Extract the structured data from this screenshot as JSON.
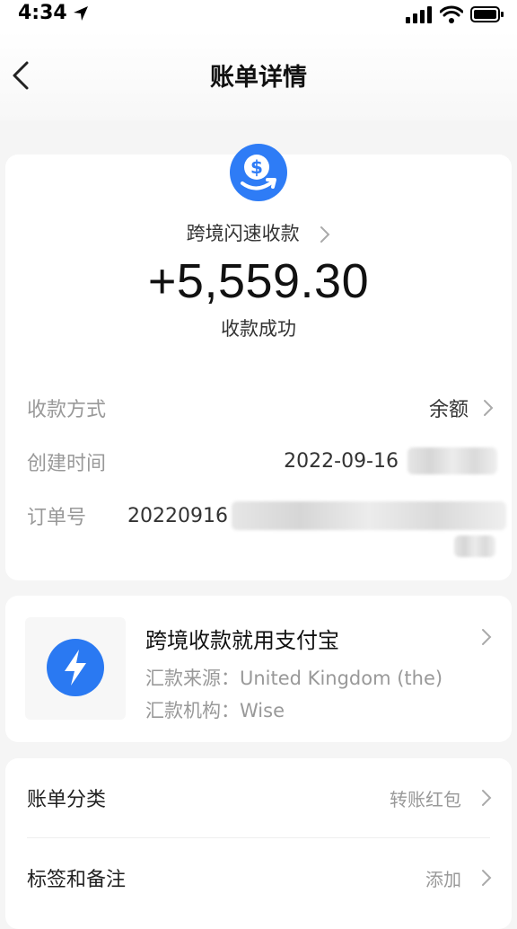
{
  "status_bar": {
    "time": "4:34"
  },
  "nav": {
    "title": "账单详情"
  },
  "summary": {
    "business_name": "跨境闪速收款",
    "amount": "+5,559.30",
    "status": "收款成功"
  },
  "details": {
    "payment_method_label": "收款方式",
    "payment_method_value": "余额",
    "created_time_label": "创建时间",
    "created_time_value": "2022-09-16",
    "order_no_label": "订单号",
    "order_no_value": "20220916"
  },
  "promo": {
    "title": "跨境收款就用支付宝",
    "source_label": "汇款来源：",
    "source_value": "United Kingdom (the)",
    "institution_label": "汇款机构：",
    "institution_value": "Wise"
  },
  "bill_category": {
    "label": "账单分类",
    "value": "转账红包"
  },
  "tags_notes": {
    "label": "标签和备注",
    "value": "添加"
  },
  "colors": {
    "accent": "#2e7cf6",
    "background": "#f5f5f5"
  }
}
